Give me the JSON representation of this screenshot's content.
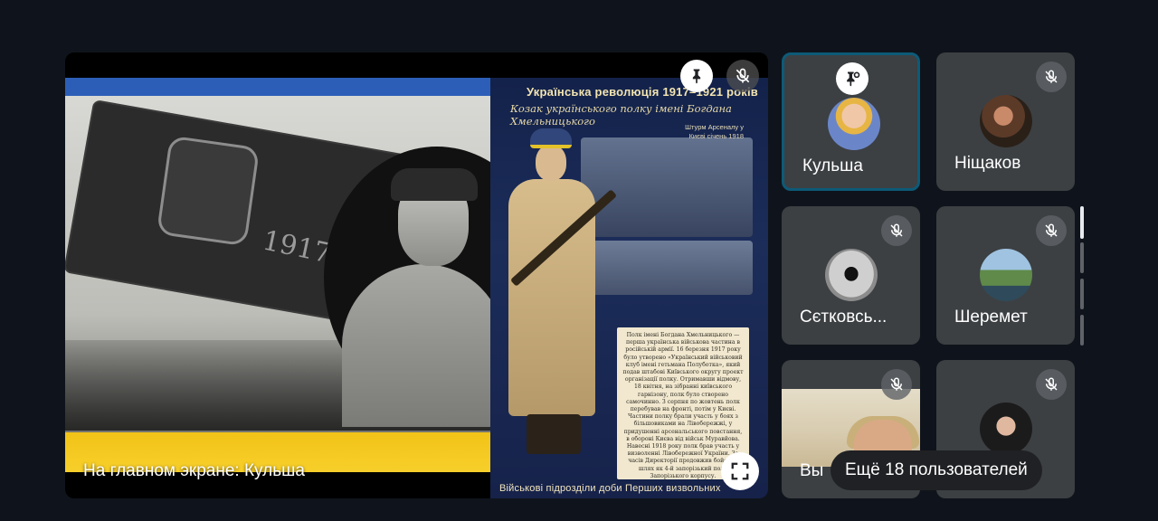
{
  "main_tile": {
    "caption": "На главном экране: Кульша",
    "poster": {
      "title": "Українська революція 1917–1921 років",
      "subtitle": "Козак українського полку імені Богдана Хмельницького",
      "note": "Штурм Арсеналу у Києві січень 1918",
      "banner_year": "1917",
      "text": "Полк імені Богдана Хмельницького — перша українська військова частина в російській армії. 16 березня 1917 року було утворено «Український військовий клуб імені гетьмана Полуботка», який подав штабові Київського округу проект організації полку. Отримавши відмову, 18 квітня, на зібранні київського гарнізону, полк було створено самочинно. З серпня по жовтень полк перебував на фронті, потім у Києві. Частини полку брали участь у боях з більшовиками на Лівобережжі, у придушенні арсенальського повстання, в обороні Києва від військ Муравйова. Навесні 1918 року полк брав участь у визволенні Лівобережної України. За часів Директорії продовжив бойовий шлях як 4-й запорізький полк Запорізького корпусу.",
      "footer": "Військові підрозділи доби Перших визвольних"
    }
  },
  "participants": [
    {
      "name": "Кульша",
      "active": true,
      "pinned": true
    },
    {
      "name": "Ніщаков",
      "active": false,
      "muted": true
    },
    {
      "name": "Сєтковсь...",
      "active": false,
      "muted": true
    },
    {
      "name": "Шеремет",
      "active": false,
      "muted": true
    },
    {
      "name": "Вы",
      "active": false,
      "muted": true,
      "camera": true
    },
    {
      "name": "",
      "active": false,
      "muted": true
    }
  ],
  "more_participants": "Ещё 18 пользователей",
  "icons": {
    "pin": "pin-icon",
    "mic_off": "mic-off-icon",
    "fullscreen": "fullscreen-icon"
  },
  "colors": {
    "background": "#0f141c",
    "tile": "#3c4043",
    "active_border": "#0d5a78",
    "flag_blue": "#2c5eb8",
    "flag_yellow": "#f2c318"
  }
}
